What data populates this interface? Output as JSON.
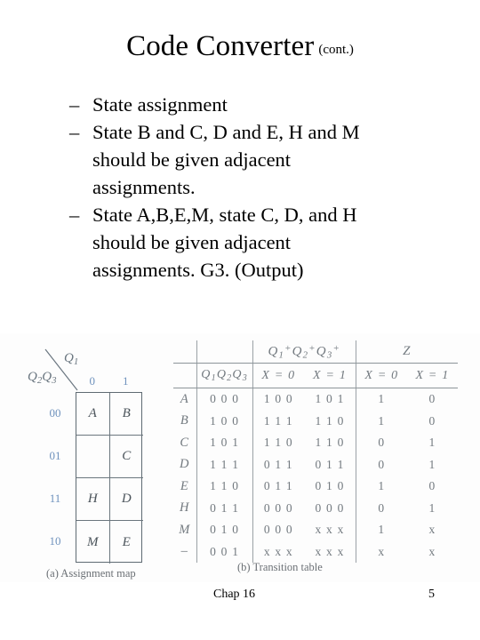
{
  "slide": {
    "title_main": "Code Converter",
    "title_cont": "(cont.)"
  },
  "bullets": [
    {
      "dash": "–",
      "lines": [
        "State assignment"
      ]
    },
    {
      "dash": "–",
      "lines": [
        "State B and C, D and E, H and M",
        "should be given adjacent",
        "assignments."
      ]
    },
    {
      "dash": "–",
      "lines": [
        "State A,B,E,M,  state C, D, and H",
        "should be given adjacent",
        "assignments. G3. (Output)"
      ]
    }
  ],
  "kmap": {
    "caption": "(a) Assignment map",
    "axis_col_label": "Q1",
    "axis_row_label": "Q2Q3",
    "col_headers": [
      "0",
      "1"
    ],
    "row_headers": [
      "00",
      "01",
      "11",
      "10"
    ],
    "cells": [
      [
        "A",
        "B"
      ],
      [
        "",
        "C"
      ],
      [
        "H",
        "D"
      ],
      [
        "M",
        "E"
      ]
    ],
    "label_color": "#6f92bd",
    "grid_color": "#5f6a72"
  },
  "transition_table": {
    "caption": "(b) Transition table",
    "group_headers": {
      "next_state": "Q1+Q2+Q3+",
      "output": "Z"
    },
    "sub_headers": {
      "state_vars": "Q1Q2Q3",
      "x0": "X = 0",
      "x1": "X = 1"
    },
    "rows": [
      {
        "state": "A",
        "q": "0 0 0",
        "ns_x0": "1 0 0",
        "ns_x1": "1 0 1",
        "z_x0": "1",
        "z_x1": "0"
      },
      {
        "state": "B",
        "q": "1 0 0",
        "ns_x0": "1 1 1",
        "ns_x1": "1 1 0",
        "z_x0": "1",
        "z_x1": "0"
      },
      {
        "state": "C",
        "q": "1 0 1",
        "ns_x0": "1 1 0",
        "ns_x1": "1 1 0",
        "z_x0": "0",
        "z_x1": "1"
      },
      {
        "state": "D",
        "q": "1 1 1",
        "ns_x0": "0 1 1",
        "ns_x1": "0 1 1",
        "z_x0": "0",
        "z_x1": "1"
      },
      {
        "state": "E",
        "q": "1 1 0",
        "ns_x0": "0 1 1",
        "ns_x1": "0 1 0",
        "z_x0": "1",
        "z_x1": "0"
      },
      {
        "state": "H",
        "q": "0 1 1",
        "ns_x0": "0 0 0",
        "ns_x1": "0 0 0",
        "z_x0": "0",
        "z_x1": "1"
      },
      {
        "state": "M",
        "q": "0 1 0",
        "ns_x0": "0 0 0",
        "ns_x1": "x x x",
        "z_x0": "1",
        "z_x1": "x"
      },
      {
        "state": "–",
        "q": "0 0 1",
        "ns_x0": "x x x",
        "ns_x1": "x x x",
        "z_x0": "x",
        "z_x1": "x"
      }
    ]
  },
  "footer": {
    "chapter": "Chap 16",
    "page_number": "5"
  }
}
